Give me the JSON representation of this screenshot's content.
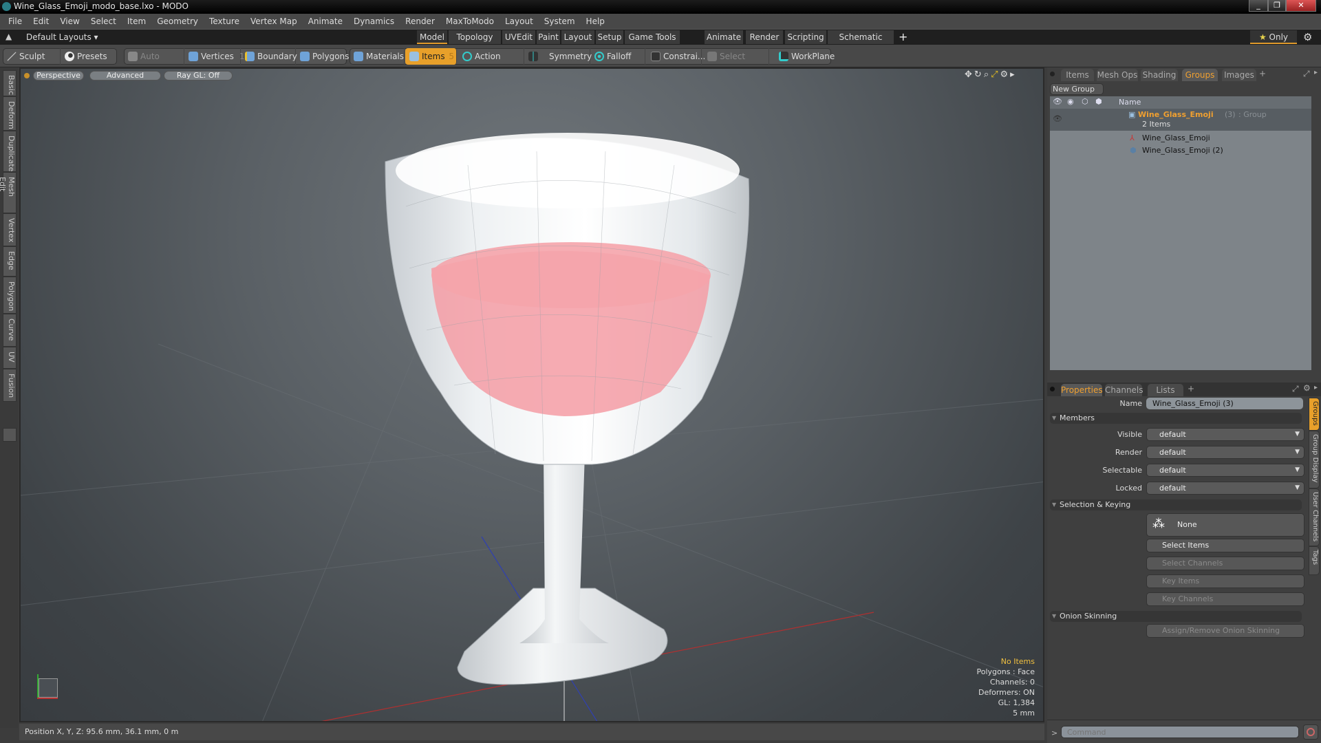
{
  "window": {
    "title": "Wine_Glass_Emoji_modo_base.lxo - MODO",
    "controls": [
      "minimize",
      "restore",
      "close"
    ]
  },
  "menu": [
    "File",
    "Edit",
    "View",
    "Select",
    "Item",
    "Geometry",
    "Texture",
    "Vertex Map",
    "Animate",
    "Dynamics",
    "Render",
    "MaxToModo",
    "Layout",
    "System",
    "Help"
  ],
  "layoutbar": {
    "layouts_label": "Default Layouts ▾",
    "tabs": [
      "Model",
      "Topology",
      "UVEdit",
      "Paint",
      "Layout",
      "Setup",
      "Game Tools",
      "Animate",
      "Render",
      "Scripting",
      "Schematic Fusion"
    ],
    "active_tab": "Model",
    "add_tab": "+",
    "only_label": "Only"
  },
  "toolbar": {
    "sculpt": "Sculpt",
    "presets": "Presets",
    "auto_select": "Auto Select",
    "vertices": "Vertices",
    "vertices_count": "1",
    "boundary": "Boundary",
    "polygons": "Polygons",
    "materials": "Materials",
    "items": "Items",
    "items_count": "5",
    "action_center": "Action Center",
    "symmetry": "Symmetry",
    "falloff": "Falloff",
    "constraints": "Constrai...",
    "select_through": "Select Through",
    "workplane": "WorkPlane"
  },
  "left_tabs": [
    "Basic",
    "Deform",
    "Duplicate",
    "Mesh Edit",
    "Vertex",
    "Edge",
    "Polygon",
    "Curve",
    "UV",
    "Fusion"
  ],
  "viewport": {
    "view_mode": "Perspective",
    "shading": "Advanced",
    "raygl": "Ray GL: Off",
    "info": {
      "selection": "No Items",
      "polygons": "Polygons : Face",
      "channels": "Channels: 0",
      "deformers": "Deformers: ON",
      "gl": "GL: 1,384",
      "grid": "5 mm"
    }
  },
  "statusbar": {
    "position": "Position X, Y, Z:   95.6 mm, 36.1 mm, 0 m"
  },
  "groups_panel": {
    "tabs": [
      "Items",
      "Mesh Ops",
      "Shading",
      "Groups",
      "Images"
    ],
    "active_tab": "Groups",
    "new_group": "New Group",
    "column_name": "Name",
    "group": {
      "name": "Wine_Glass_Emoji",
      "count": "(3)",
      "type": ": Group",
      "sub": "2 Items"
    },
    "children": [
      "Wine_Glass_Emoji",
      "Wine_Glass_Emoji (2)"
    ]
  },
  "properties_panel": {
    "tabs": [
      "Properties",
      "Channels",
      "Lists"
    ],
    "active_tab": "Properties",
    "name_label": "Name",
    "name_value": "Wine_Glass_Emoji (3)",
    "members_section": "Members",
    "fields": [
      {
        "label": "Visible",
        "value": "default"
      },
      {
        "label": "Render",
        "value": "default"
      },
      {
        "label": "Selectable",
        "value": "default"
      },
      {
        "label": "Locked",
        "value": "default"
      }
    ],
    "selection_section": "Selection & Keying",
    "none_button": "None",
    "select_items": "Select Items",
    "select_channels": "Select Channels",
    "key_items": "Key Items",
    "key_channels": "Key Channels",
    "onion_section": "Onion Skinning",
    "onion_button": "Assign/Remove Onion Skinning",
    "side_tabs": [
      "Groups",
      "Group Display",
      "User Channels",
      "Tags"
    ]
  },
  "command": {
    "prompt": ">",
    "placeholder": "Command"
  }
}
